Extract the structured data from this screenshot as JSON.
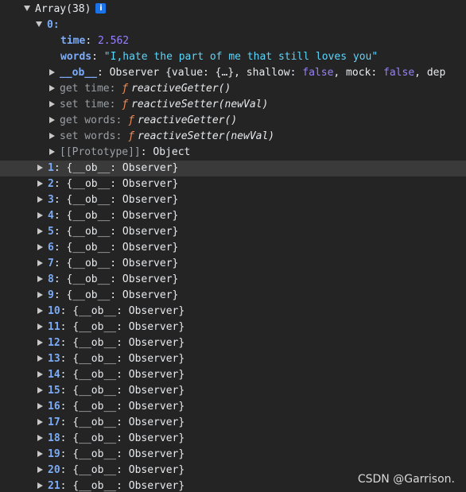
{
  "root": {
    "label": "Array(38)",
    "info": "i"
  },
  "item0": {
    "index": "0",
    "time_key": "time",
    "time_value": "2.562",
    "words_key": "words",
    "words_value": "\"I,hate the part of me that still loves you\"",
    "ob_key": "__ob__",
    "ob_value_prefix": "Observer {value: {…}, shallow: ",
    "ob_shallow": "false",
    "ob_mock_label": ", mock: ",
    "ob_mock": "false",
    "ob_tail": ", dep",
    "get_time_label": "get time",
    "get_time_fn": "reactiveGetter()",
    "set_time_label": "set time",
    "set_time_fn": "reactiveSetter(newVal)",
    "get_words_label": "get words",
    "get_words_fn": "reactiveGetter()",
    "set_words_label": "set words",
    "set_words_fn": "reactiveSetter(newVal)",
    "f_glyph": "ƒ",
    "proto_key": "[[Prototype]]",
    "proto_value": "Object"
  },
  "collapsed_value": "{__ob__: Observer}",
  "rows": [
    {
      "index": "1"
    },
    {
      "index": "2"
    },
    {
      "index": "3"
    },
    {
      "index": "4"
    },
    {
      "index": "5"
    },
    {
      "index": "6"
    },
    {
      "index": "7"
    },
    {
      "index": "8"
    },
    {
      "index": "9"
    },
    {
      "index": "10"
    },
    {
      "index": "11"
    },
    {
      "index": "12"
    },
    {
      "index": "13"
    },
    {
      "index": "14"
    },
    {
      "index": "15"
    },
    {
      "index": "16"
    },
    {
      "index": "17"
    },
    {
      "index": "18"
    },
    {
      "index": "19"
    },
    {
      "index": "20"
    },
    {
      "index": "21"
    }
  ],
  "watermark": "CSDN @Garrison.",
  "colors": {
    "background": "#242424",
    "key": "#7cacf8",
    "number": "#9980ff",
    "string": "#5cd5fb",
    "function_glyph": "#f28b54",
    "accessor": "#9aa0a6"
  }
}
